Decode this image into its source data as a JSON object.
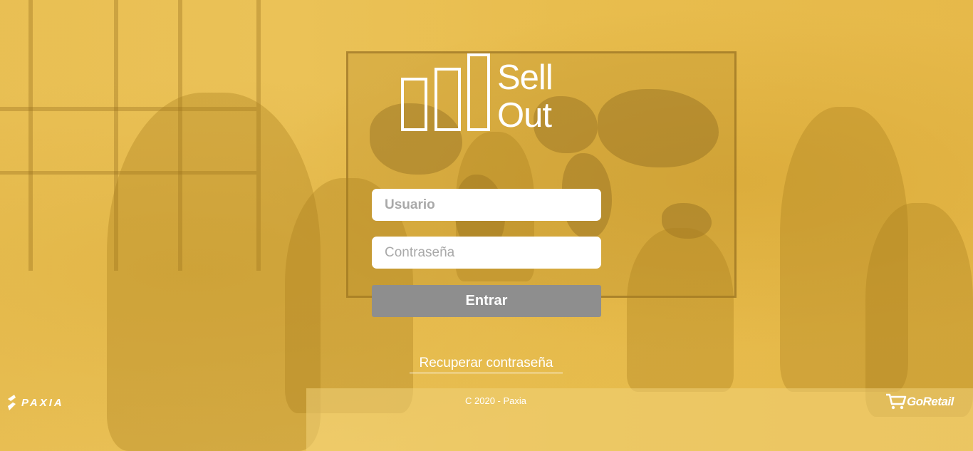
{
  "logo": {
    "line1": "Sell",
    "line2": "Out"
  },
  "form": {
    "username_placeholder": "Usuario",
    "username_value": "",
    "password_placeholder": "Contraseña",
    "password_value": "",
    "submit_label": "Entrar",
    "recover_label": "Recuperar contraseña"
  },
  "footer": {
    "copyright": "C 2020 - Paxia"
  },
  "brands": {
    "left": "PAXIA",
    "right": "GoRetail"
  },
  "colors": {
    "overlay": "#e8bd50",
    "button": "#8e8e8e",
    "text": "#ffffff"
  },
  "icons": {
    "logo": "bar-chart-icon",
    "left_brand": "paxia-logo-icon",
    "right_brand": "shopping-cart-icon"
  }
}
